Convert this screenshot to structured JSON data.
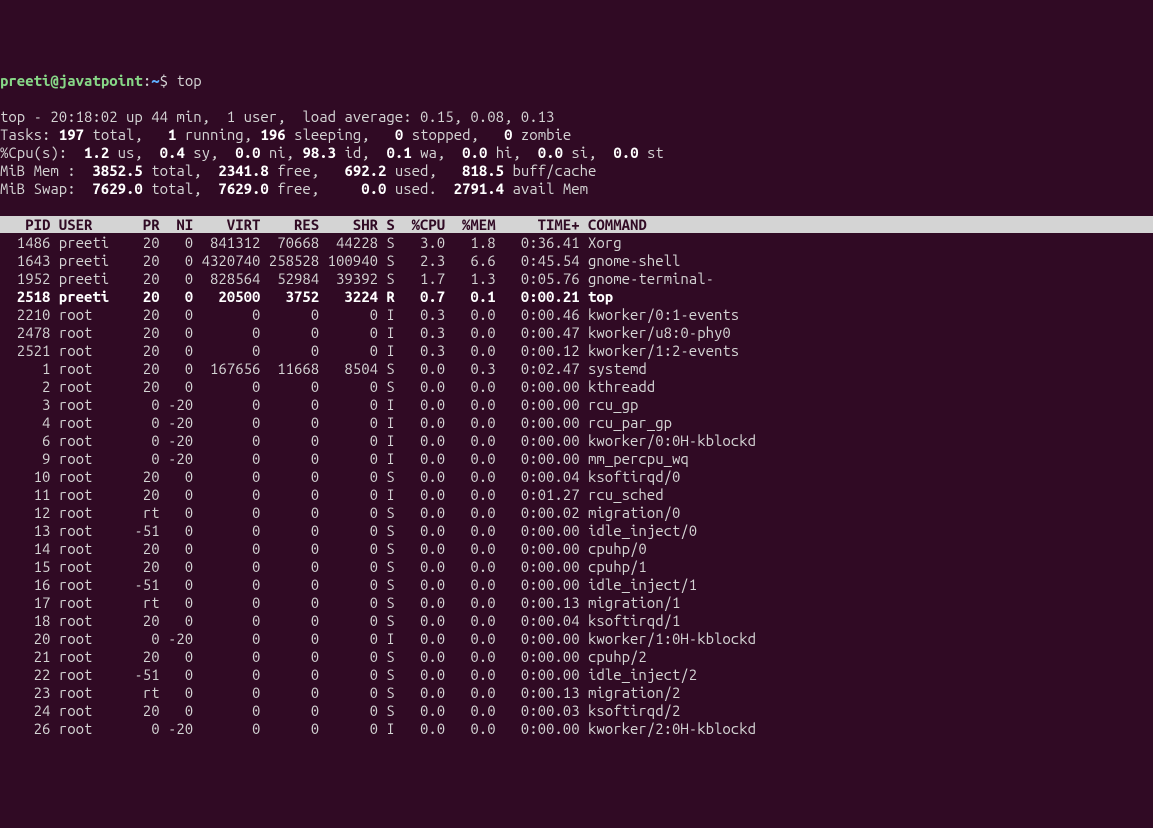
{
  "prompt": {
    "user": "preeti",
    "at": "@",
    "host": "javatpoint",
    "colon": ":",
    "path": "~",
    "dollar": "$ ",
    "command": "top"
  },
  "summary": {
    "line1_a": "top - 20:18:02 up 44 min,  1 user,  load average: 0.15, 0.08, 0.13",
    "tasks_label": "Tasks: ",
    "tasks_total": "197 ",
    "tasks_total_l": "total,   ",
    "tasks_running": "1 ",
    "tasks_running_l": "running, ",
    "tasks_sleeping": "196 ",
    "tasks_sleeping_l": "sleeping,   ",
    "tasks_stopped": "0 ",
    "tasks_stopped_l": "stopped,   ",
    "tasks_zombie": "0 ",
    "tasks_zombie_l": "zombie",
    "cpu_label": "%Cpu(s):  ",
    "cpu_us": "1.2 ",
    "cpu_us_l": "us,  ",
    "cpu_sy": "0.4 ",
    "cpu_sy_l": "sy,  ",
    "cpu_ni": "0.0 ",
    "cpu_ni_l": "ni, ",
    "cpu_id": "98.3 ",
    "cpu_id_l": "id,  ",
    "cpu_wa": "0.1 ",
    "cpu_wa_l": "wa,  ",
    "cpu_hi": "0.0 ",
    "cpu_hi_l": "hi,  ",
    "cpu_si": "0.0 ",
    "cpu_si_l": "si,  ",
    "cpu_st": "0.0 ",
    "cpu_st_l": "st",
    "mem_label": "MiB Mem :  ",
    "mem_total": "3852.5 ",
    "mem_total_l": "total,  ",
    "mem_free": "2341.8 ",
    "mem_free_l": "free,   ",
    "mem_used": "692.2 ",
    "mem_used_l": "used,   ",
    "mem_buff": "818.5 ",
    "mem_buff_l": "buff/cache",
    "swap_label": "MiB Swap:  ",
    "swap_total": "7629.0 ",
    "swap_total_l": "total,  ",
    "swap_free": "7629.0 ",
    "swap_free_l": "free,     ",
    "swap_used": "0.0 ",
    "swap_used_l": "used.  ",
    "swap_avail": "2791.4 ",
    "swap_avail_l": "avail Mem"
  },
  "header": "   PID USER      PR  NI    VIRT    RES    SHR S  %CPU  %MEM     TIME+ COMMAND                                                                     ",
  "rows": [
    {
      "pid": "1486",
      "user": "preeti",
      "pr": "20",
      "ni": "0",
      "virt": "841312",
      "res": "70668",
      "shr": "44228",
      "s": "S",
      "cpu": "3.0",
      "mem": "1.8",
      "time": "0:36.41",
      "cmd": "Xorg",
      "hl": false
    },
    {
      "pid": "1643",
      "user": "preeti",
      "pr": "20",
      "ni": "0",
      "virt": "4320740",
      "res": "258528",
      "shr": "100940",
      "s": "S",
      "cpu": "2.3",
      "mem": "6.6",
      "time": "0:45.54",
      "cmd": "gnome-shell",
      "hl": false
    },
    {
      "pid": "1952",
      "user": "preeti",
      "pr": "20",
      "ni": "0",
      "virt": "828564",
      "res": "52984",
      "shr": "39392",
      "s": "S",
      "cpu": "1.7",
      "mem": "1.3",
      "time": "0:05.76",
      "cmd": "gnome-terminal-",
      "hl": false
    },
    {
      "pid": "2518",
      "user": "preeti",
      "pr": "20",
      "ni": "0",
      "virt": "20500",
      "res": "3752",
      "shr": "3224",
      "s": "R",
      "cpu": "0.7",
      "mem": "0.1",
      "time": "0:00.21",
      "cmd": "top",
      "hl": true
    },
    {
      "pid": "2210",
      "user": "root",
      "pr": "20",
      "ni": "0",
      "virt": "0",
      "res": "0",
      "shr": "0",
      "s": "I",
      "cpu": "0.3",
      "mem": "0.0",
      "time": "0:00.46",
      "cmd": "kworker/0:1-events",
      "hl": false
    },
    {
      "pid": "2478",
      "user": "root",
      "pr": "20",
      "ni": "0",
      "virt": "0",
      "res": "0",
      "shr": "0",
      "s": "I",
      "cpu": "0.3",
      "mem": "0.0",
      "time": "0:00.47",
      "cmd": "kworker/u8:0-phy0",
      "hl": false
    },
    {
      "pid": "2521",
      "user": "root",
      "pr": "20",
      "ni": "0",
      "virt": "0",
      "res": "0",
      "shr": "0",
      "s": "I",
      "cpu": "0.3",
      "mem": "0.0",
      "time": "0:00.12",
      "cmd": "kworker/1:2-events",
      "hl": false
    },
    {
      "pid": "1",
      "user": "root",
      "pr": "20",
      "ni": "0",
      "virt": "167656",
      "res": "11668",
      "shr": "8504",
      "s": "S",
      "cpu": "0.0",
      "mem": "0.3",
      "time": "0:02.47",
      "cmd": "systemd",
      "hl": false
    },
    {
      "pid": "2",
      "user": "root",
      "pr": "20",
      "ni": "0",
      "virt": "0",
      "res": "0",
      "shr": "0",
      "s": "S",
      "cpu": "0.0",
      "mem": "0.0",
      "time": "0:00.00",
      "cmd": "kthreadd",
      "hl": false
    },
    {
      "pid": "3",
      "user": "root",
      "pr": "0",
      "ni": "-20",
      "virt": "0",
      "res": "0",
      "shr": "0",
      "s": "I",
      "cpu": "0.0",
      "mem": "0.0",
      "time": "0:00.00",
      "cmd": "rcu_gp",
      "hl": false
    },
    {
      "pid": "4",
      "user": "root",
      "pr": "0",
      "ni": "-20",
      "virt": "0",
      "res": "0",
      "shr": "0",
      "s": "I",
      "cpu": "0.0",
      "mem": "0.0",
      "time": "0:00.00",
      "cmd": "rcu_par_gp",
      "hl": false
    },
    {
      "pid": "6",
      "user": "root",
      "pr": "0",
      "ni": "-20",
      "virt": "0",
      "res": "0",
      "shr": "0",
      "s": "I",
      "cpu": "0.0",
      "mem": "0.0",
      "time": "0:00.00",
      "cmd": "kworker/0:0H-kblockd",
      "hl": false
    },
    {
      "pid": "9",
      "user": "root",
      "pr": "0",
      "ni": "-20",
      "virt": "0",
      "res": "0",
      "shr": "0",
      "s": "I",
      "cpu": "0.0",
      "mem": "0.0",
      "time": "0:00.00",
      "cmd": "mm_percpu_wq",
      "hl": false
    },
    {
      "pid": "10",
      "user": "root",
      "pr": "20",
      "ni": "0",
      "virt": "0",
      "res": "0",
      "shr": "0",
      "s": "S",
      "cpu": "0.0",
      "mem": "0.0",
      "time": "0:00.04",
      "cmd": "ksoftirqd/0",
      "hl": false
    },
    {
      "pid": "11",
      "user": "root",
      "pr": "20",
      "ni": "0",
      "virt": "0",
      "res": "0",
      "shr": "0",
      "s": "I",
      "cpu": "0.0",
      "mem": "0.0",
      "time": "0:01.27",
      "cmd": "rcu_sched",
      "hl": false
    },
    {
      "pid": "12",
      "user": "root",
      "pr": "rt",
      "ni": "0",
      "virt": "0",
      "res": "0",
      "shr": "0",
      "s": "S",
      "cpu": "0.0",
      "mem": "0.0",
      "time": "0:00.02",
      "cmd": "migration/0",
      "hl": false
    },
    {
      "pid": "13",
      "user": "root",
      "pr": "-51",
      "ni": "0",
      "virt": "0",
      "res": "0",
      "shr": "0",
      "s": "S",
      "cpu": "0.0",
      "mem": "0.0",
      "time": "0:00.00",
      "cmd": "idle_inject/0",
      "hl": false
    },
    {
      "pid": "14",
      "user": "root",
      "pr": "20",
      "ni": "0",
      "virt": "0",
      "res": "0",
      "shr": "0",
      "s": "S",
      "cpu": "0.0",
      "mem": "0.0",
      "time": "0:00.00",
      "cmd": "cpuhp/0",
      "hl": false
    },
    {
      "pid": "15",
      "user": "root",
      "pr": "20",
      "ni": "0",
      "virt": "0",
      "res": "0",
      "shr": "0",
      "s": "S",
      "cpu": "0.0",
      "mem": "0.0",
      "time": "0:00.00",
      "cmd": "cpuhp/1",
      "hl": false
    },
    {
      "pid": "16",
      "user": "root",
      "pr": "-51",
      "ni": "0",
      "virt": "0",
      "res": "0",
      "shr": "0",
      "s": "S",
      "cpu": "0.0",
      "mem": "0.0",
      "time": "0:00.00",
      "cmd": "idle_inject/1",
      "hl": false
    },
    {
      "pid": "17",
      "user": "root",
      "pr": "rt",
      "ni": "0",
      "virt": "0",
      "res": "0",
      "shr": "0",
      "s": "S",
      "cpu": "0.0",
      "mem": "0.0",
      "time": "0:00.13",
      "cmd": "migration/1",
      "hl": false
    },
    {
      "pid": "18",
      "user": "root",
      "pr": "20",
      "ni": "0",
      "virt": "0",
      "res": "0",
      "shr": "0",
      "s": "S",
      "cpu": "0.0",
      "mem": "0.0",
      "time": "0:00.04",
      "cmd": "ksoftirqd/1",
      "hl": false
    },
    {
      "pid": "20",
      "user": "root",
      "pr": "0",
      "ni": "-20",
      "virt": "0",
      "res": "0",
      "shr": "0",
      "s": "I",
      "cpu": "0.0",
      "mem": "0.0",
      "time": "0:00.00",
      "cmd": "kworker/1:0H-kblockd",
      "hl": false
    },
    {
      "pid": "21",
      "user": "root",
      "pr": "20",
      "ni": "0",
      "virt": "0",
      "res": "0",
      "shr": "0",
      "s": "S",
      "cpu": "0.0",
      "mem": "0.0",
      "time": "0:00.00",
      "cmd": "cpuhp/2",
      "hl": false
    },
    {
      "pid": "22",
      "user": "root",
      "pr": "-51",
      "ni": "0",
      "virt": "0",
      "res": "0",
      "shr": "0",
      "s": "S",
      "cpu": "0.0",
      "mem": "0.0",
      "time": "0:00.00",
      "cmd": "idle_inject/2",
      "hl": false
    },
    {
      "pid": "23",
      "user": "root",
      "pr": "rt",
      "ni": "0",
      "virt": "0",
      "res": "0",
      "shr": "0",
      "s": "S",
      "cpu": "0.0",
      "mem": "0.0",
      "time": "0:00.13",
      "cmd": "migration/2",
      "hl": false
    },
    {
      "pid": "24",
      "user": "root",
      "pr": "20",
      "ni": "0",
      "virt": "0",
      "res": "0",
      "shr": "0",
      "s": "S",
      "cpu": "0.0",
      "mem": "0.0",
      "time": "0:00.03",
      "cmd": "ksoftirqd/2",
      "hl": false
    },
    {
      "pid": "26",
      "user": "root",
      "pr": "0",
      "ni": "-20",
      "virt": "0",
      "res": "0",
      "shr": "0",
      "s": "I",
      "cpu": "0.0",
      "mem": "0.0",
      "time": "0:00.00",
      "cmd": "kworker/2:0H-kblockd",
      "hl": false
    }
  ]
}
